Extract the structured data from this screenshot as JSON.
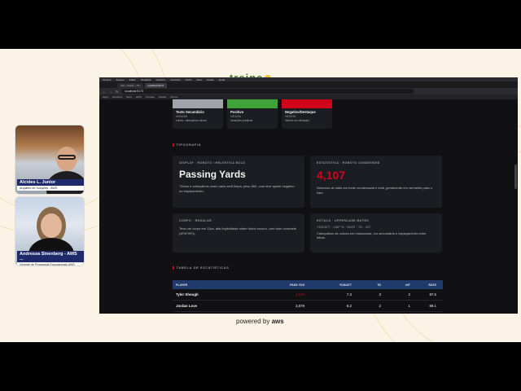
{
  "stage": {
    "brand": "treina",
    "powered_by": "powered by",
    "aws": "aws"
  },
  "cameras": [
    {
      "name": "Alcides L. Junior",
      "role": "Arquiteto de Soluções - AWS"
    },
    {
      "name": "Andressa Sinenberg - AWS ...",
      "role": "Gerente de Programas Educacionais AWS"
    }
  ],
  "browser": {
    "menubar": [
      "Chrome",
      "Arquivo",
      "Editar",
      "Visualizar",
      "Histórico",
      "Favoritos",
      "Perfis",
      "Guia",
      "Janela",
      "Ajuda"
    ],
    "tabs": [
      {
        "label": "Vite + React + TS",
        "active": false
      },
      {
        "label": "localhost:5173",
        "active": true
      }
    ],
    "url": "localhost:5173",
    "bookmarks": [
      "Apps",
      "Favoritos",
      "Docs",
      "AWS",
      "Console",
      "GitHub",
      "Outros"
    ]
  },
  "colors": {
    "secondary_text_swatch": "#A0A4AB",
    "positive_swatch": "#3FA33A",
    "negative_swatch": "#D0021B",
    "table_header_bg": "#1F3A6B"
  },
  "swatches": [
    {
      "title": "Texto Secundário",
      "hex": "#A0A4AB",
      "usage": "Labels, cabeçalhos coluna"
    },
    {
      "title": "Positivo",
      "hex": "#3FA33A",
      "usage": "Variações positivas"
    },
    {
      "title": "Negativo/Destaque",
      "hex": "#D0021B",
      "usage": "Valores em destaque"
    }
  ],
  "typography": {
    "section": "TIPOGRAFIA",
    "display": {
      "kicker": "DISPLAY · ROBOTO / HELVETICA BOLD",
      "sample": "Passing Yards",
      "desc": "Títulos e cabeçalhos usam sans-serif limpa, peso 800, com leve ajuste negativo no espaçamento."
    },
    "stat": {
      "kicker": "ESTATÍSTICA · ROBOTO CONDENSED",
      "sample": "4,107",
      "desc": "Números de stats em fonte condensada e bold, geralmente em vermelho para o líder."
    },
    "body": {
      "kicker": "CORPO · REGULAR",
      "desc": "Texto de corpo em 13px, alta legibilidade sobre fundo escuro, com bom contraste (#F0F0F0)."
    },
    "label": {
      "kicker": "RÓTULO · UPPERCASE MUTED",
      "sample": "YDS/ATT · CMP % · RATE · TD · INT",
      "desc": "Cabeçalhos de coluna em maiúsculas, cor secundária e espaçamento entre letras."
    }
  },
  "table": {
    "section": "TABELA DE ESTATÍSTICAS",
    "headers": [
      "PLAYER",
      "PASS YDS",
      "YDS/ATT",
      "TD",
      "INT",
      "RATE"
    ],
    "rows": [
      {
        "player": "Tyler Shough",
        "yds": "4,107",
        "ypa": "7.3",
        "td": "3",
        "int": "2",
        "rate": "87.6"
      },
      {
        "player": "Jordan Love",
        "yds": "3,879",
        "ypa": "8.2",
        "td": "2",
        "int": "1",
        "rate": "88.1"
      }
    ]
  }
}
